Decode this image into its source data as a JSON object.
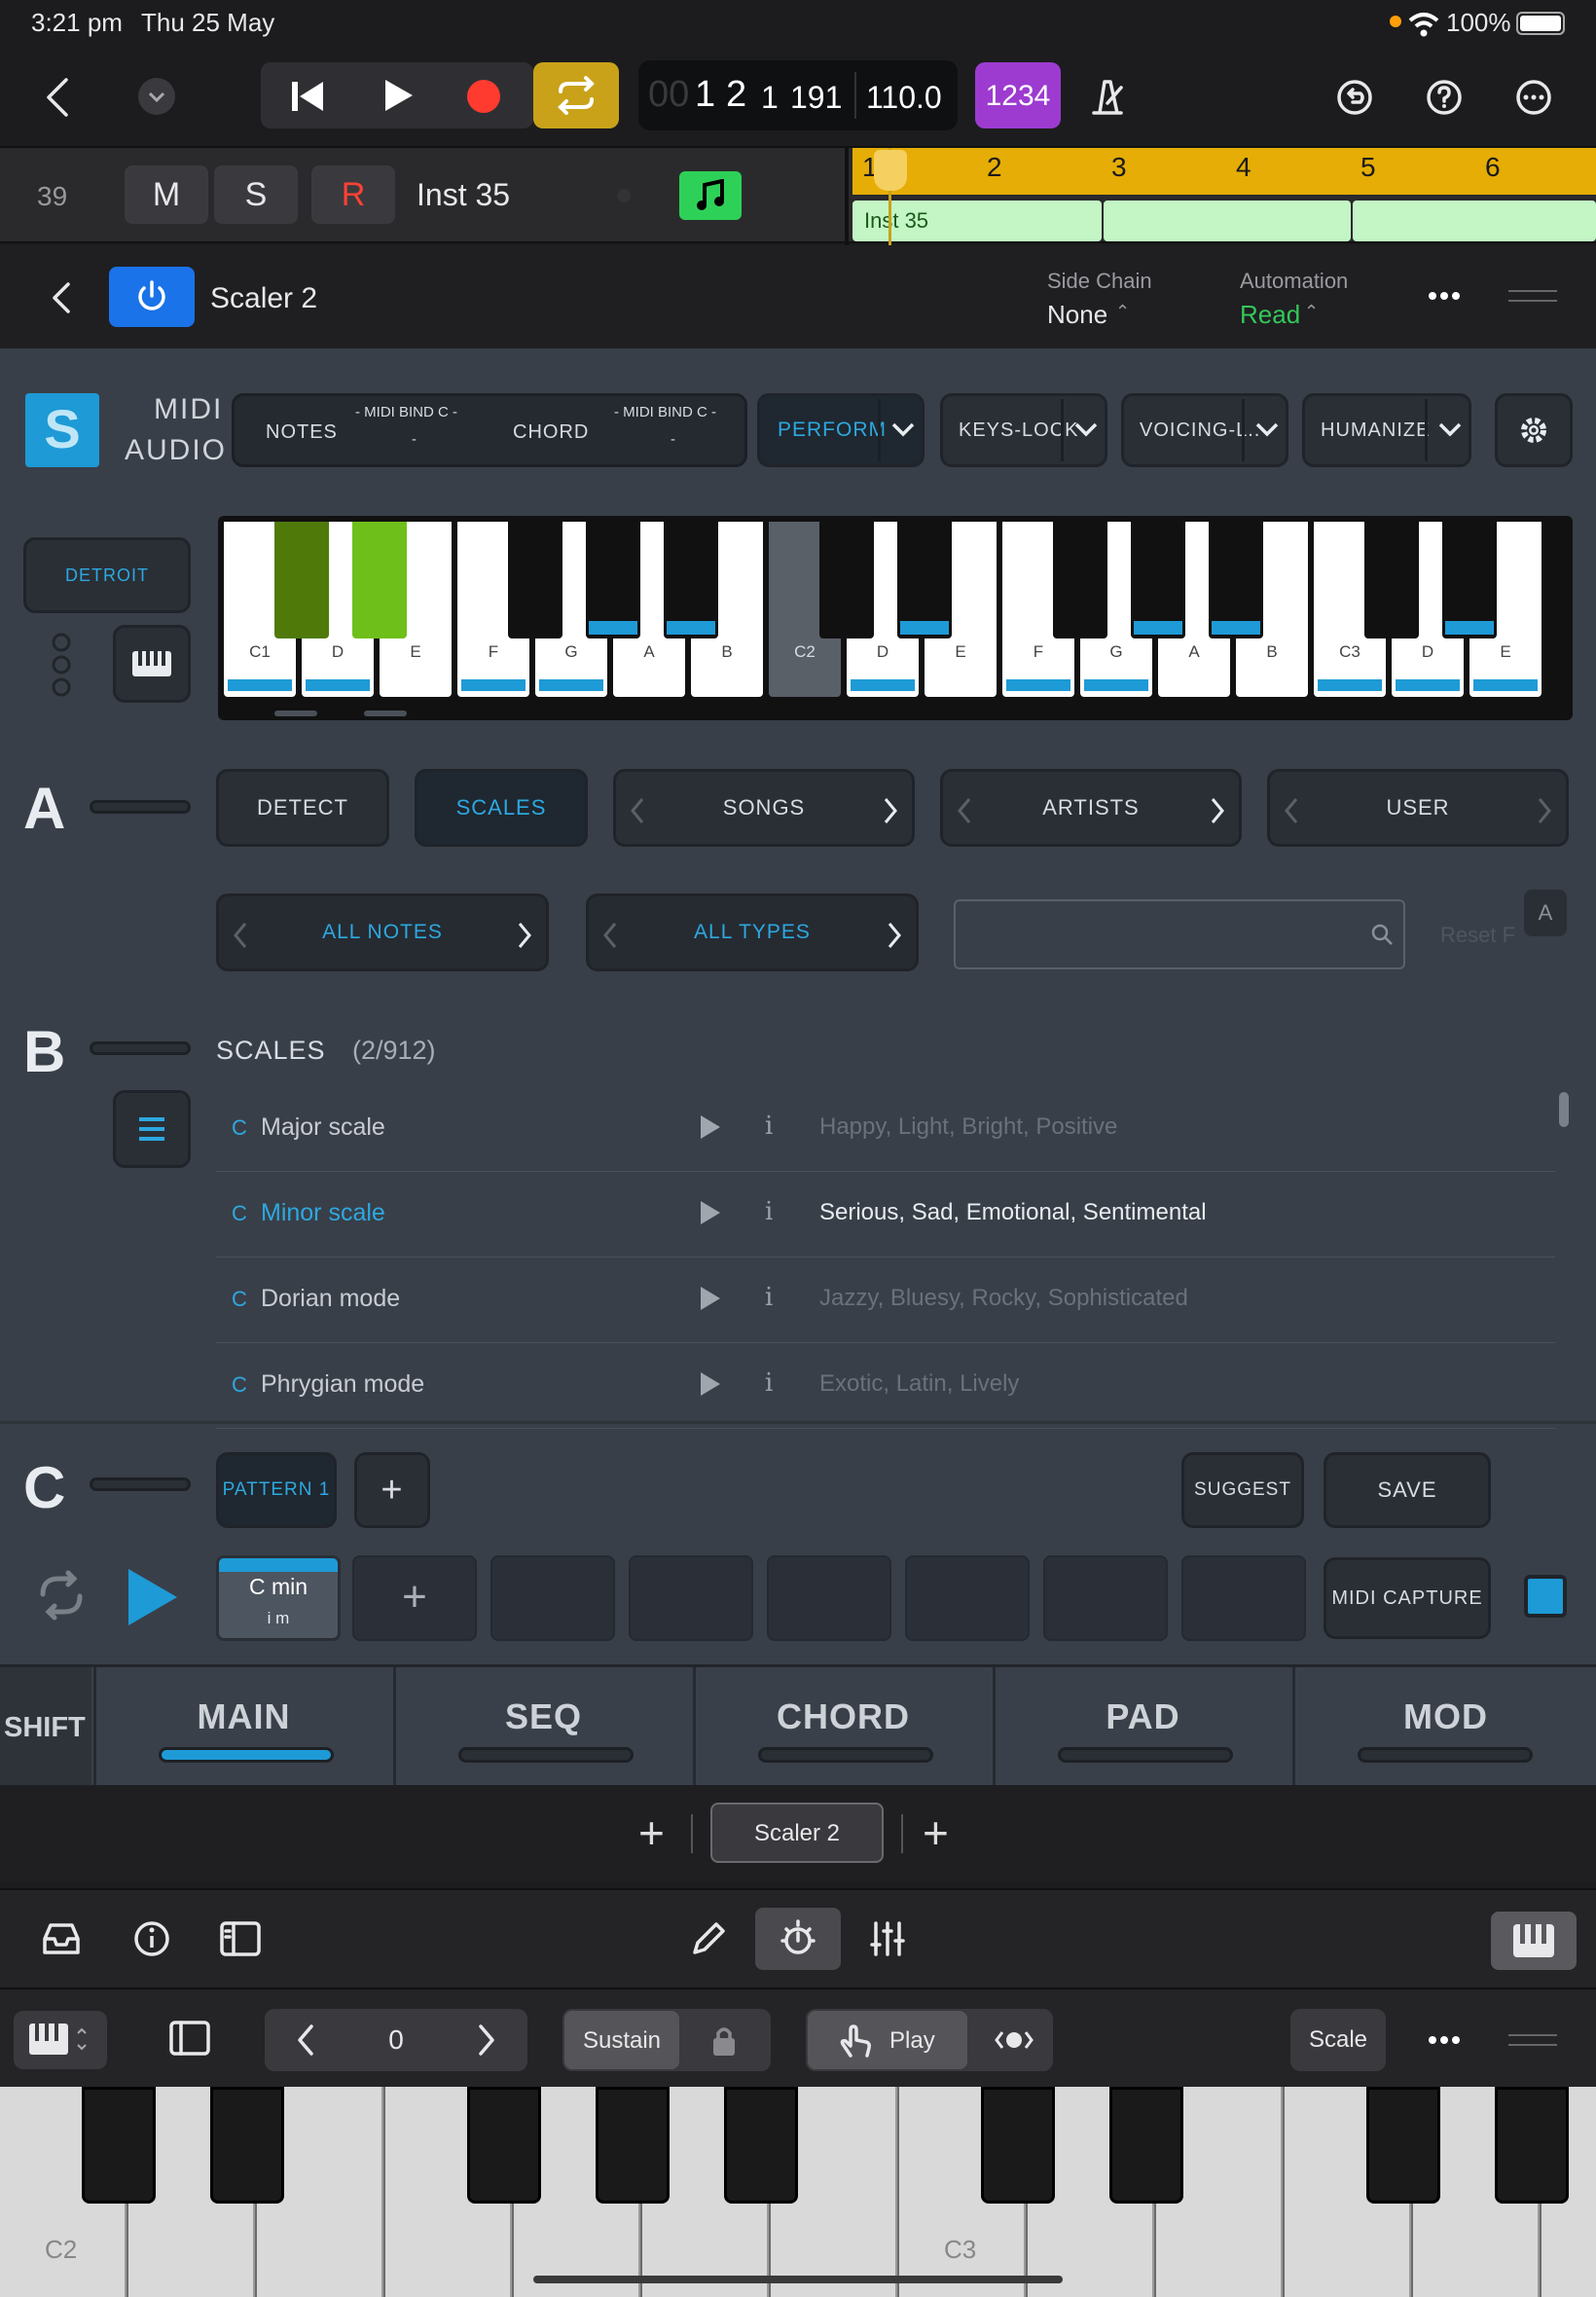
{
  "status_bar": {
    "time": "3:21 pm",
    "date": "Thu 25 May",
    "battery": "100%"
  },
  "transport": {
    "position_faint": "00",
    "bar": "1",
    "beat": "2",
    "sub": "1",
    "ticks": "191",
    "tempo": "110.0",
    "count_in": "1234"
  },
  "track": {
    "number": "39",
    "mute": "M",
    "solo": "S",
    "record": "R",
    "name": "Inst 35",
    "ruler": [
      "1",
      "2",
      "3",
      "4",
      "5",
      "6"
    ],
    "region_name": "Inst 35"
  },
  "plugin_header": {
    "name": "Scaler 2",
    "side_chain_label": "Side Chain",
    "side_chain_value": "None",
    "automation_label": "Automation",
    "automation_value": "Read",
    "automation_color": "#34c759"
  },
  "scaler": {
    "logo_letter": "S",
    "midi_label": "MIDI",
    "audio_label": "AUDIO",
    "notes_label": "NOTES",
    "chord_label": "CHORD",
    "notes_bind": "- MIDI BIND C -",
    "notes_bind_value": "-",
    "chord_bind": "- MIDI BIND C -",
    "chord_bind_value": "-",
    "perform": "PERFORM",
    "keys_lock": "KEYS-LOCK",
    "voicing": "VOICING-L..",
    "humanize": "HUMANIZE",
    "preset": "DETROIT",
    "keys": [
      "C1",
      "D",
      "E",
      "F",
      "G",
      "A",
      "B",
      "C2",
      "D",
      "E",
      "F",
      "G",
      "A",
      "B",
      "C3",
      "D",
      "E"
    ],
    "accent_color": "#1e9ad6",
    "section_a": {
      "letter": "A",
      "detect": "DETECT",
      "scales": "SCALES",
      "songs": "SONGS",
      "artists": "ARTISTS",
      "user": "USER",
      "all_notes": "ALL NOTES",
      "all_types": "ALL TYPES",
      "search_placeholder": "",
      "reset": "Reset F",
      "a_badge": "A"
    },
    "section_b": {
      "letter": "B",
      "title": "SCALES",
      "count": "(2/912)",
      "rows": [
        {
          "key": "C",
          "name": "Major scale",
          "tags": "Happy, Light, Bright, Positive"
        },
        {
          "key": "C",
          "name": "Minor scale",
          "tags": "Serious, Sad, Emotional, Sentimental"
        },
        {
          "key": "C",
          "name": "Dorian mode",
          "tags": "Jazzy, Bluesy, Rocky, Sophisticated"
        },
        {
          "key": "C",
          "name": "Phrygian mode",
          "tags": "Exotic, Latin, Lively"
        }
      ]
    },
    "section_c": {
      "letter": "C",
      "pattern": "PATTERN 1",
      "suggest": "SUGGEST",
      "save": "SAVE",
      "chord_name": "C min",
      "chord_degree": "i m",
      "midi_capture": "MIDI CAPTURE"
    },
    "tabs": {
      "shift": "SHIFT",
      "main": "MAIN",
      "seq": "SEQ",
      "chord": "CHORD",
      "pad": "PAD",
      "mod": "MOD"
    }
  },
  "plugin_strip": {
    "slot": "Scaler 2"
  },
  "keyboard_controls": {
    "octave": "0",
    "sustain": "Sustain",
    "play": "Play",
    "scale": "Scale"
  },
  "bottom_keyboard": {
    "c2": "C2",
    "c3": "C3"
  }
}
